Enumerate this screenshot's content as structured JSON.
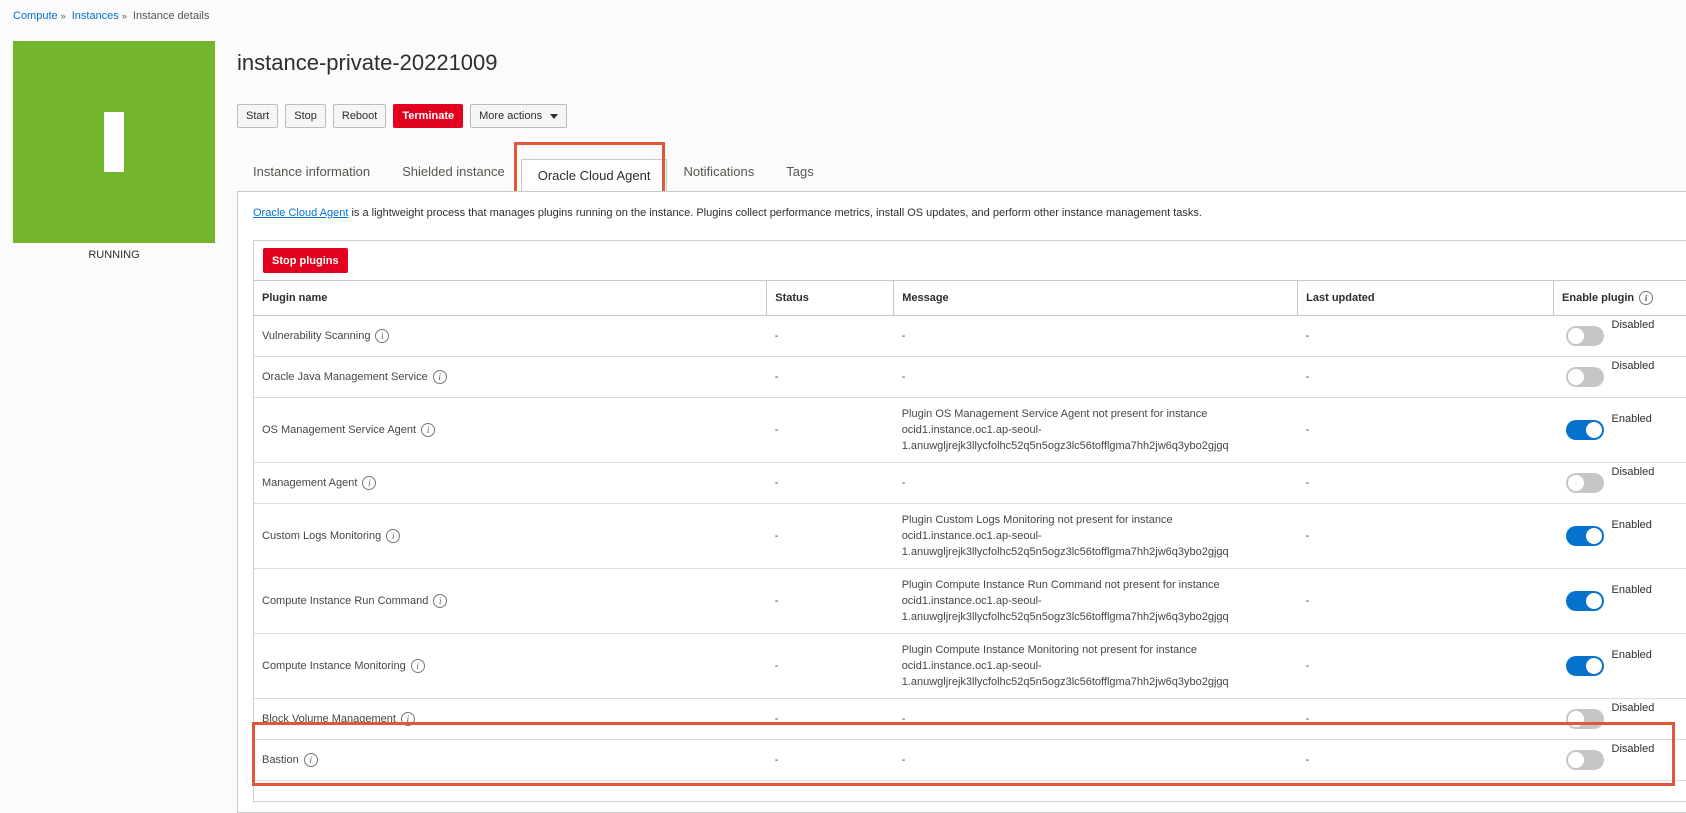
{
  "breadcrumb": {
    "items": [
      "Compute",
      "Instances",
      "Instance details"
    ]
  },
  "instance": {
    "tile_letter": "I",
    "state": "RUNNING",
    "name": "instance-private-20221009"
  },
  "actions": {
    "start": "Start",
    "stop": "Stop",
    "reboot": "Reboot",
    "terminate": "Terminate",
    "more": "More actions"
  },
  "tabs": [
    "Instance information",
    "Shielded instance",
    "Oracle Cloud Agent",
    "Notifications",
    "Tags"
  ],
  "intro": {
    "link": "Oracle Cloud Agent",
    "text": " is a lightweight process that manages plugins running on the instance. Plugins collect performance metrics, install OS updates, and perform other instance management tasks."
  },
  "table": {
    "stop_button": "Stop plugins",
    "headers": [
      "Plugin name",
      "Status",
      "Message",
      "Last updated",
      "Enable plugin"
    ],
    "rows": [
      {
        "name": "Vulnerability Scanning",
        "status": "-",
        "message": [
          "-"
        ],
        "updated": "-",
        "enabled": false,
        "label": "Disabled"
      },
      {
        "name": "Oracle Java Management Service",
        "status": "-",
        "message": [
          "-"
        ],
        "updated": "-",
        "enabled": false,
        "label": "Disabled"
      },
      {
        "name": "OS Management Service Agent",
        "status": "-",
        "message": [
          "Plugin OS Management Service Agent not present for instance",
          "ocid1.instance.oc1.ap-seoul-",
          "1.anuwgljrejk3llycfolhc52q5n5ogz3lc56tofflgma7hh2jw6q3ybo2gjgq"
        ],
        "updated": "-",
        "enabled": true,
        "label": "Enabled"
      },
      {
        "name": "Management Agent",
        "status": "-",
        "message": [
          "-"
        ],
        "updated": "-",
        "enabled": false,
        "label": "Disabled"
      },
      {
        "name": "Custom Logs Monitoring",
        "status": "-",
        "message": [
          "Plugin Custom Logs Monitoring not present for instance",
          "ocid1.instance.oc1.ap-seoul-",
          "1.anuwgljrejk3llycfolhc52q5n5ogz3lc56tofflgma7hh2jw6q3ybo2gjgq"
        ],
        "updated": "-",
        "enabled": true,
        "label": "Enabled"
      },
      {
        "name": "Compute Instance Run Command",
        "status": "-",
        "message": [
          "Plugin Compute Instance Run Command not present for instance",
          "ocid1.instance.oc1.ap-seoul-",
          "1.anuwgljrejk3llycfolhc52q5n5ogz3lc56tofflgma7hh2jw6q3ybo2gjgq"
        ],
        "updated": "-",
        "enabled": true,
        "label": "Enabled"
      },
      {
        "name": "Compute Instance Monitoring",
        "status": "-",
        "message": [
          "Plugin Compute Instance Monitoring not present for instance",
          "ocid1.instance.oc1.ap-seoul-",
          "1.anuwgljrejk3llycfolhc52q5n5ogz3lc56tofflgma7hh2jw6q3ybo2gjgq"
        ],
        "updated": "-",
        "enabled": true,
        "label": "Enabled"
      },
      {
        "name": "Block Volume Management",
        "status": "-",
        "message": [
          "-"
        ],
        "updated": "-",
        "enabled": false,
        "label": "Disabled"
      },
      {
        "name": "Bastion",
        "status": "-",
        "message": [
          "-"
        ],
        "updated": "-",
        "enabled": false,
        "label": "Disabled"
      }
    ]
  },
  "colors": {
    "running": "#73b62c",
    "danger": "#e1001e",
    "link": "#0572ce",
    "highlight": "#e2573b",
    "toggle_on": "#0572ce"
  }
}
